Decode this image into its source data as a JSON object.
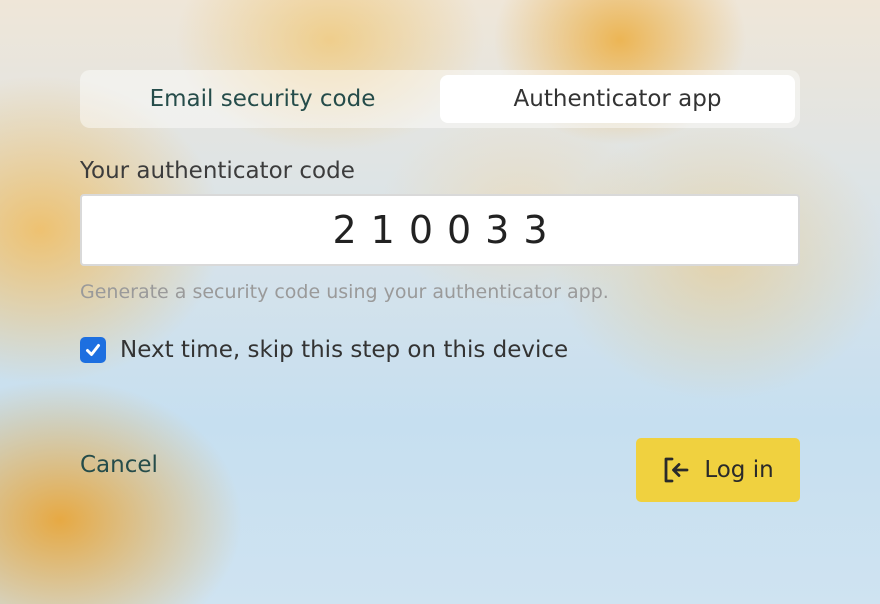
{
  "tabs": [
    {
      "label": "Email security code",
      "active": false
    },
    {
      "label": "Authenticator app",
      "active": true
    }
  ],
  "form": {
    "code_label": "Your authenticator code",
    "code_value": "210033",
    "hint": "Generate a security code using your authenticator app.",
    "remember_checked": true,
    "remember_label": "Next time, skip this step on this device"
  },
  "actions": {
    "cancel_label": "Cancel",
    "login_label": "Log in",
    "login_icon": "login-arrow-icon"
  },
  "colors": {
    "accent_button": "#f0d13f",
    "checkbox": "#1d6fe0",
    "tab_text": "#254c4a"
  }
}
